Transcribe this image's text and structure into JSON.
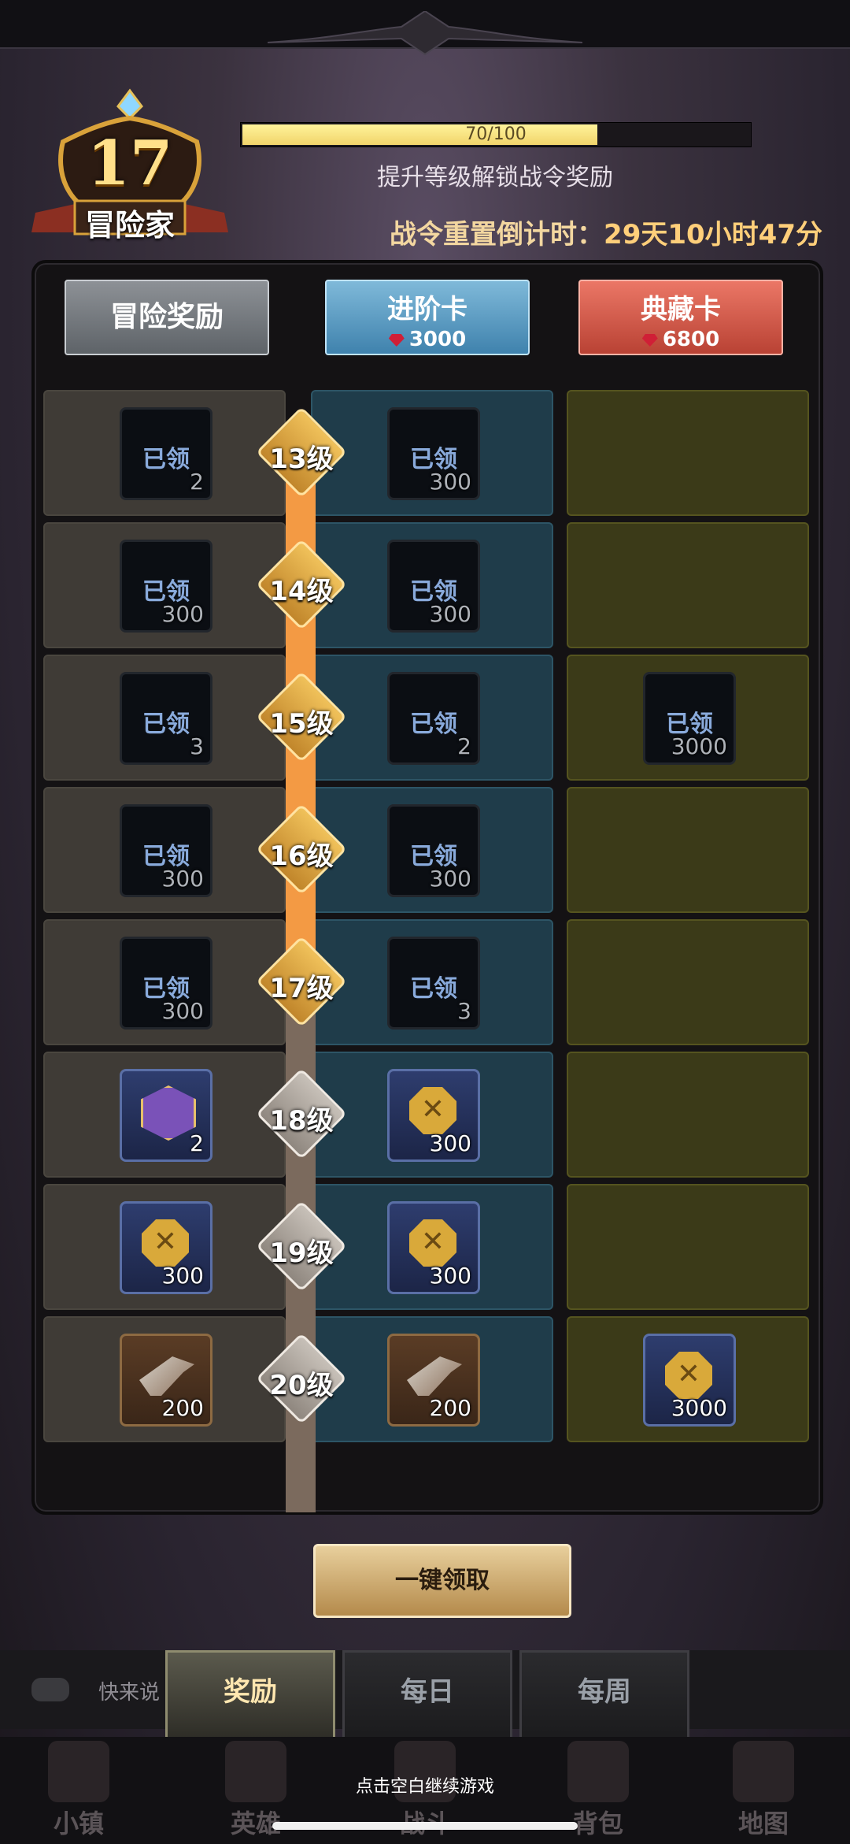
{
  "level": {
    "number": "17",
    "title": "冒险家"
  },
  "xp": {
    "text": "70/100",
    "current": 70,
    "max": 100
  },
  "subtitle": "提升等级解锁战令奖励",
  "countdown": {
    "label": "战令重置倒计时：",
    "value": "29天10小时47分"
  },
  "columns": {
    "free": {
      "name": "冒险奖励"
    },
    "advanced": {
      "name": "进阶卡",
      "cost": "3000"
    },
    "collector": {
      "name": "典藏卡",
      "cost": "6800"
    }
  },
  "claimed_label": "已领",
  "rows": [
    {
      "level": "13级",
      "free": {
        "qty": "2",
        "state": "claimed"
      },
      "adv": {
        "qty": "300",
        "state": "claimed"
      },
      "col": null
    },
    {
      "level": "14级",
      "free": {
        "qty": "300",
        "state": "claimed"
      },
      "adv": {
        "qty": "300",
        "state": "claimed"
      },
      "col": null
    },
    {
      "level": "15级",
      "free": {
        "qty": "3",
        "state": "claimed"
      },
      "adv": {
        "qty": "2",
        "state": "claimed"
      },
      "col": {
        "qty": "3000",
        "state": "claimed"
      }
    },
    {
      "level": "16级",
      "free": {
        "qty": "300",
        "state": "claimed"
      },
      "adv": {
        "qty": "300",
        "state": "claimed"
      },
      "col": null
    },
    {
      "level": "17级",
      "free": {
        "qty": "300",
        "state": "claimed"
      },
      "adv": {
        "qty": "3",
        "state": "claimed"
      },
      "col": null
    },
    {
      "level": "18级",
      "free": {
        "qty": "2",
        "state": "locked",
        "icon": "purple-emblem-icon"
      },
      "adv": {
        "qty": "300",
        "state": "locked",
        "icon": "gold-coin-icon"
      },
      "col": null
    },
    {
      "level": "19级",
      "free": {
        "qty": "300",
        "state": "locked",
        "icon": "gold-coin-icon"
      },
      "adv": {
        "qty": "300",
        "state": "locked",
        "icon": "gold-coin-icon"
      },
      "col": null
    },
    {
      "level": "20级",
      "free": {
        "qty": "200",
        "state": "locked",
        "icon": "axe-icon"
      },
      "adv": {
        "qty": "200",
        "state": "locked",
        "icon": "axe-icon"
      },
      "col": {
        "qty": "3000",
        "state": "locked",
        "icon": "gold-coin-icon"
      }
    }
  ],
  "claim_all_button": "一键领取",
  "chat_placeholder": "快来说",
  "tabs": [
    "奖励",
    "每日",
    "每周"
  ],
  "hint": "点击空白继续游戏",
  "bottom_nav": [
    "小镇",
    "英雄",
    "战斗",
    "背包",
    "地图"
  ],
  "colors": {
    "accent": "#f39a44",
    "xp_fill": "#f1d46b",
    "gem": "#d01f36"
  }
}
